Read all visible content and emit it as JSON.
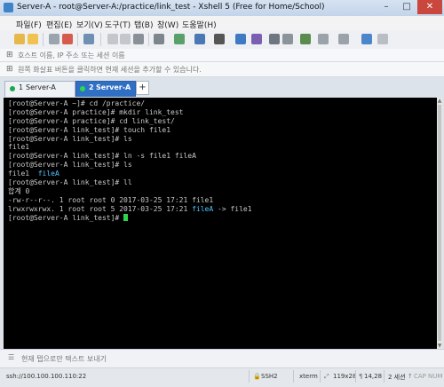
{
  "window": {
    "title": "Server-A - root@Server-A:/practice/link_test - Xshell 5 (Free for Home/School)",
    "minimize": "–",
    "maximize": "□",
    "close": "✕"
  },
  "menu": [
    "파일(F)",
    "편집(E)",
    "보기(V)",
    "도구(T)",
    "탭(B)",
    "창(W)",
    "도움말(H)"
  ],
  "address_bar": {
    "placeholder": "호스트 이름, IP 주소 또는 세션 이름",
    "icon": "host-icon"
  },
  "session_bar": {
    "text": "원쪽 화살표 버튼을 클릭하면 현재 세션을 추가할 수 있습니다.",
    "icon": "session-icon"
  },
  "tabs": [
    {
      "number": "1",
      "label": "Server-A",
      "active": false,
      "status_color": "#1aa84a"
    },
    {
      "number": "2",
      "label": "Server-A",
      "active": true,
      "status_color": "#2bd84a"
    }
  ],
  "tab_add": "+",
  "terminal": {
    "background": "#000000",
    "text_color": "#c8c8c8",
    "highlight_color": "#4fc3ff",
    "cursor_color": "#2bd84a",
    "lines": [
      "[root@Server-A ~]# cd /practice/",
      "[root@Server-A practice]# mkdir link_test",
      "[root@Server-A practice]# cd link_test/",
      "[root@Server-A link_test]# touch file1",
      "[root@Server-A link_test]# ls",
      "file1",
      "[root@Server-A link_test]# ln -s file1 fileA",
      "[root@Server-A link_test]# ls",
      "file1  fileA",
      "[root@Server-A link_test]# ll",
      "합계 0",
      "-rw-r--r--. 1 root root 0 2017-03-25 17:21 file1",
      "lrwxrwxrwx. 1 root root 5 2017-03-25 17:21 fileA -> file1",
      "[root@Server-A link_test]# "
    ]
  },
  "compose_bar": {
    "placeholder": "현재 탭으로만 텍스트 보내기",
    "icon": "compose-icon"
  },
  "status_bar": {
    "address": "ssh://100.100.100.110:22",
    "protocol": "SSH2",
    "terminal_type": "xterm",
    "size": "119x28",
    "position": "14,28",
    "sessions": "2 세션",
    "caps": "CAP",
    "num": "NUM"
  }
}
